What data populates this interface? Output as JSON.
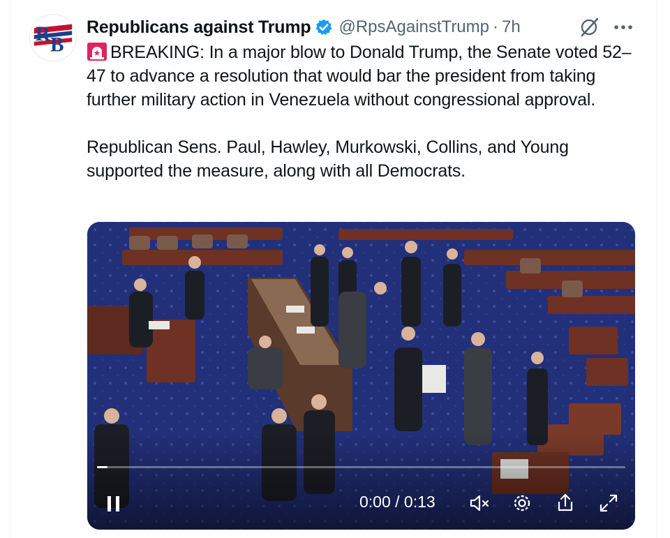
{
  "author": {
    "display_name": "Republicans against Trump",
    "handle": "@RpsAgainstTrump",
    "separator": "·",
    "time": "7h",
    "avatar_text": "RB"
  },
  "tweet": {
    "paragraph1": "BREAKING: In a major blow to Donald Trump, the Senate voted 52–47 to advance a resolution that would bar the president from taking further military action in Venezuela without congressional approval.",
    "paragraph2": "Republican Sens. Paul, Hawley, Murkowski, Collins, and Young supported the measure, along with all Democrats.",
    "emoji_icon": "rotating-light-icon"
  },
  "video": {
    "time_current": "0:00",
    "time_total": "0:13",
    "time_display": "0:00 / 0:13",
    "progress": 0.0,
    "state": "playing",
    "controls": [
      "pause-icon",
      "muted-speaker-icon",
      "settings-gear-icon",
      "share-icon",
      "fullscreen-icon"
    ]
  },
  "colors": {
    "text": "#0f1419",
    "secondary": "#536471",
    "verified": "#1d9bf0",
    "carpet": "#1f2c6e",
    "desk_wood": "#6b2f22"
  }
}
